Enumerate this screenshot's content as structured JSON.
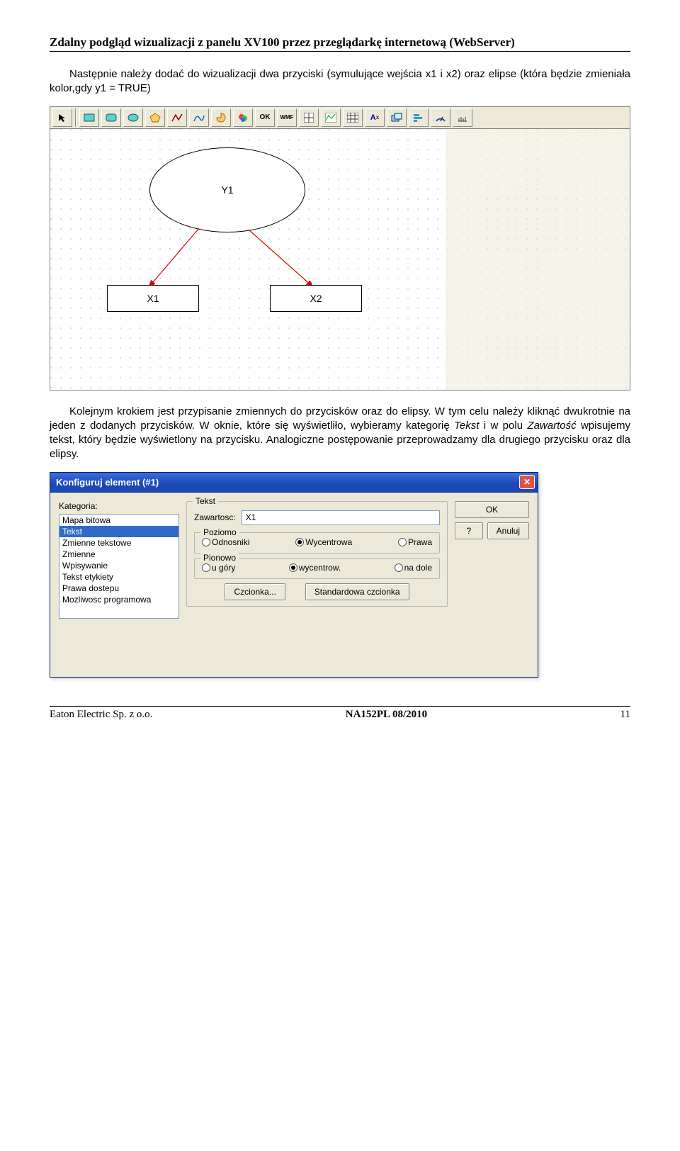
{
  "header": "Zdalny podgląd wizualizacji z panelu XV100 przez przeglądarkę internetową (WebServer)",
  "paragraph1": "Następnie należy dodać do wizualizacji dwa przyciski (symulujące wejścia x1 i x2) oraz elipse (która będzie zmieniała kolor,gdy y1 = TRUE)",
  "editor": {
    "ellipse_label": "Y1",
    "button1_label": "X1",
    "button2_label": "X2",
    "toolbar_icons": [
      "pointer-icon",
      "rect-icon",
      "rounded-rect-icon",
      "ellipse-icon",
      "polygon-icon",
      "line-icon",
      "curve-icon",
      "pie-icon",
      "image-icon",
      "ok-icon",
      "wmf-icon",
      "grid-icon",
      "trend-icon",
      "table-icon",
      "ax-icon",
      "layer-icon",
      "hchart-icon",
      "meter-icon",
      "scale-icon"
    ],
    "ok_label": "OK",
    "wmf_label": "WMF"
  },
  "paragraph2_prefix": "Kolejnym krokiem jest przypisanie zmiennych do przycisków oraz do elipsy. W tym celu należy kliknąć dwukrotnie na jeden z dodanych przycisków. W oknie, które się wyświetliło, wybieramy kategorię ",
  "paragraph2_italic1": "Tekst",
  "paragraph2_mid": " i w polu ",
  "paragraph2_italic2": "Zawartość",
  "paragraph2_suffix": " wpisujemy tekst, który będzie wyświetlony na przycisku. Analogiczne postępowanie przeprowadzamy dla drugiego przycisku oraz dla elipsy.",
  "dialog": {
    "title": "Konfiguruj element (#1)",
    "category_label": "Kategoria:",
    "categories": [
      "Mapa bitowa",
      "Tekst",
      "Zmienne tekstowe",
      "Zmienne",
      "Wpisywanie",
      "Tekst etykiety",
      "Prawa dostepu",
      "Mozliwosc programowa"
    ],
    "selected_category_index": 1,
    "group_tekst": "Tekst",
    "content_label": "Zawartosc:",
    "content_value": "X1",
    "group_horizontal": "Poziomo",
    "horiz_options": [
      "Odnosniki",
      "Wycentrowa",
      "Prawa"
    ],
    "horiz_selected": 1,
    "group_vertical": "Pionowo",
    "vert_options": [
      "u góry",
      "wycentrow.",
      "na dole"
    ],
    "vert_selected": 1,
    "font_button": "Czcionka...",
    "std_font_button": "Standardowa czcionka",
    "ok_button": "OK",
    "help_button": "?",
    "cancel_button": "Anuluj"
  },
  "footer": {
    "left": "Eaton Electric Sp. z o.o.",
    "center": "NA152PL 08/2010",
    "right": "11"
  }
}
